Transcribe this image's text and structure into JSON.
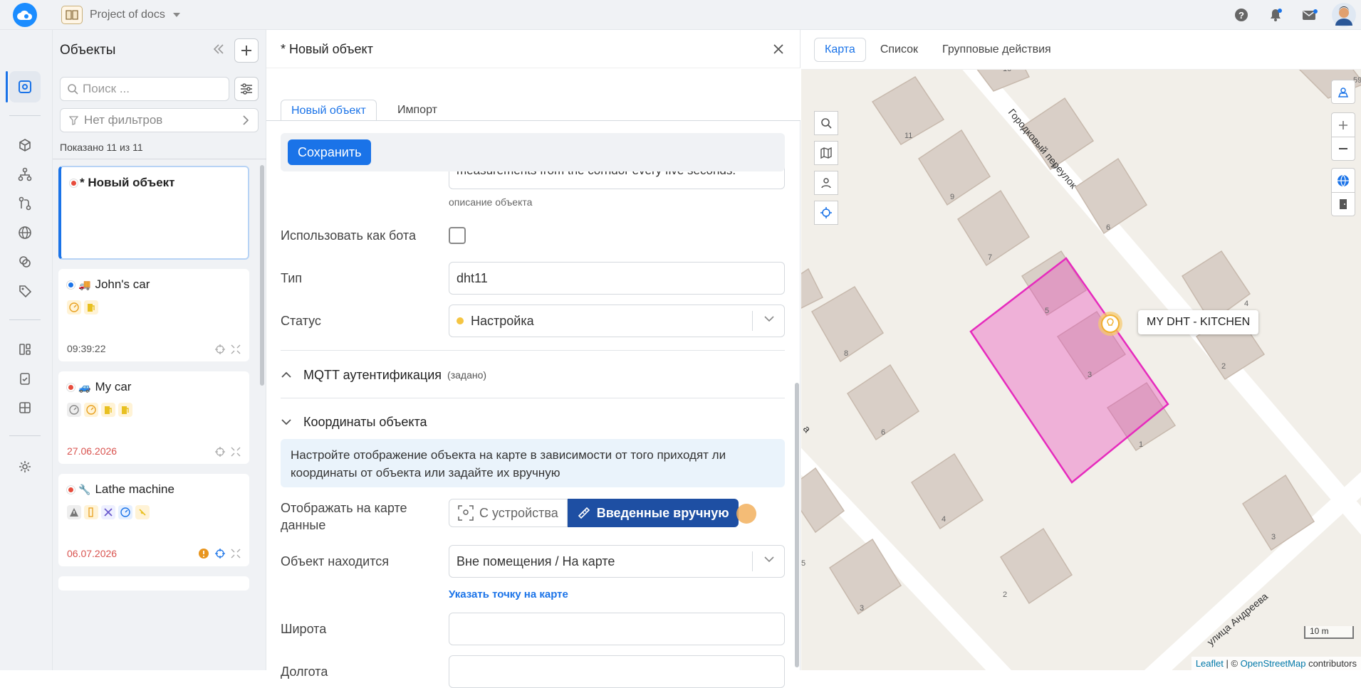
{
  "topbar": {
    "project_name": "Project of docs"
  },
  "left_panel": {
    "title": "Объекты",
    "search_placeholder": "Поиск ...",
    "filters_label": "Нет фильтров",
    "count_label": "Показано 11 из 11",
    "cards": [
      {
        "name": "* Новый объект",
        "status_color": "#e74c3c",
        "time": ""
      },
      {
        "name": "John's car",
        "status_color": "#1a73e8",
        "time": "09:39:22"
      },
      {
        "name": "My car",
        "status_color": "#e74c3c",
        "time": "27.06.2026"
      },
      {
        "name": "Lathe machine",
        "status_color": "#e74c3c",
        "time": "06.07.2026"
      }
    ]
  },
  "editor": {
    "title": "* Новый объект",
    "tabs": [
      "Новый объект",
      "Импорт"
    ],
    "save_label": "Сохранить",
    "description_text": "measurements from the corridor every five seconds.",
    "description_hint": "описание объекта",
    "use_as_bot_label": "Использовать как бота",
    "type_label": "Тип",
    "type_value": "dht11",
    "status_label": "Статус",
    "status_value": "Настройка",
    "status_dot_color": "#f5c542",
    "mqtt_section": "MQTT аутентификация",
    "mqtt_section_sub": "(задано)",
    "coords_section": "Координаты объекта",
    "coords_info": "Настройте отображение объекта на карте в зависимости от того приходят ли координаты от объекта или задайте их вручную",
    "show_on_map_label": "Отображать на карте данные",
    "seg_device": "С устройства",
    "seg_manual": "Введенные вручную",
    "location_label": "Объект находится",
    "location_value": "Вне помещения / На карте",
    "pick_point_link": "Указать точку на карте",
    "lat_label": "Широта",
    "lon_label": "Долгота"
  },
  "map_panel": {
    "tabs": [
      "Карта",
      "Список",
      "Групповые действия"
    ],
    "object_label": "MY DHT - KITCHEN",
    "street_1": "Городковый переулок",
    "street_2": "улица Андреева",
    "street_3": "а",
    "house_numbers": [
      "11",
      "8",
      "9",
      "6",
      "7",
      "5",
      "3",
      "2",
      "8",
      "6",
      "1",
      "4",
      "5",
      "2",
      "3",
      "3",
      "59",
      "10",
      "4"
    ],
    "scale_label": "10 m",
    "attribution_leaflet": "Leaflet",
    "attribution_sep": " | © ",
    "attribution_osm": "OpenStreetMap",
    "attribution_suffix": " contributors"
  }
}
